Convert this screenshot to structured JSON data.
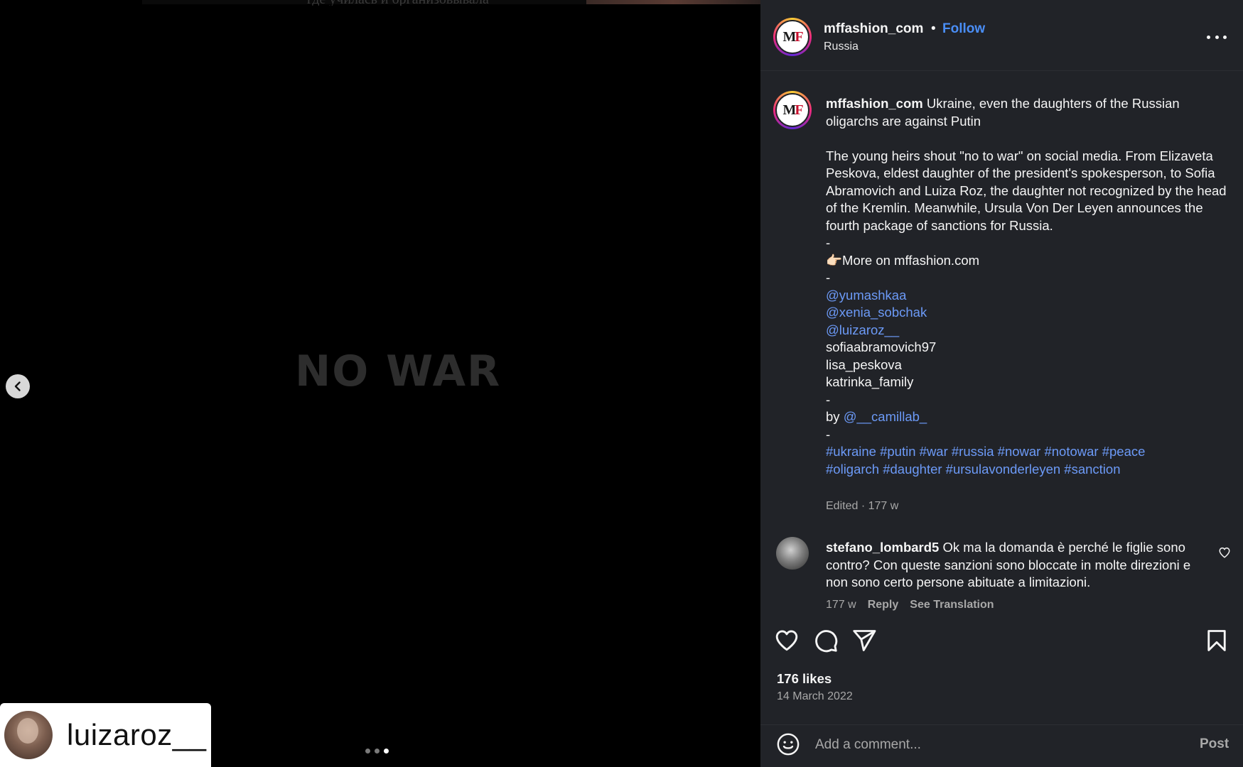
{
  "media": {
    "russian_text": "где училась и организовывала",
    "headline": "NO WAR",
    "prev_icon": "chevron-left-icon",
    "slides": [
      false,
      false,
      true
    ],
    "tag": {
      "username": "luizaroz__"
    }
  },
  "header": {
    "username": "mffashion_com",
    "separator": "•",
    "follow_label": "Follow",
    "location": "Russia",
    "avatar_letters": {
      "m": "M",
      "f": "F"
    },
    "more_icon": "more-horizontal-icon"
  },
  "caption": {
    "username": "mffashion_com",
    "title": "Ukraine, even the daughters of the Russian oligarchs are against Putin",
    "body": "The young heirs shout \"no to war\" on social media. From Elizaveta Peskova, eldest daughter of the president's spokesperson, to Sofia Abramovich and Luiza Roz, the daughter not recognized by the head of the Kremlin. Meanwhile, Ursula Von Der Leyen announces the fourth package of sanctions for Russia.",
    "dash": "-",
    "more_emoji": "👉🏻",
    "more_text": "More on mffashion.com",
    "mentions": [
      "@yumashkaa",
      "@xenia_sobchak",
      "@luizaroz__"
    ],
    "plain_names": [
      "sofiaabramovich97",
      "lisa_peskova",
      "katrinka_family"
    ],
    "by_label": "by",
    "by_mention": "@__camillab_",
    "hashtags_line1": "#ukraine #putin #war #russia #nowar #notowar #peace",
    "hashtags_line2": "#oligarch #daughter #ursulavonderleyen #sanction",
    "meta": "Edited · 177 w"
  },
  "comment": {
    "username": "stefano_lombard5",
    "text": "Ok ma la domanda è perché le figlie sono contro? Con queste sanzioni sono bloccate in molte direzioni e non sono certo persone abituate a limitazioni.",
    "age": "177 w",
    "reply_label": "Reply",
    "translate_label": "See Translation"
  },
  "actions": {
    "like_icon": "heart-icon",
    "comment_icon": "comment-icon",
    "share_icon": "send-icon",
    "save_icon": "bookmark-icon"
  },
  "likes": "176 likes",
  "date": "14 March 2022",
  "comment_box": {
    "emoji_icon": "smiley-icon",
    "placeholder": "Add a comment...",
    "post_label": "Post"
  },
  "colors": {
    "panel_bg": "#212328",
    "link": "#6c9af7",
    "follow": "#4a8ef7",
    "muted": "#a8a8a8"
  }
}
